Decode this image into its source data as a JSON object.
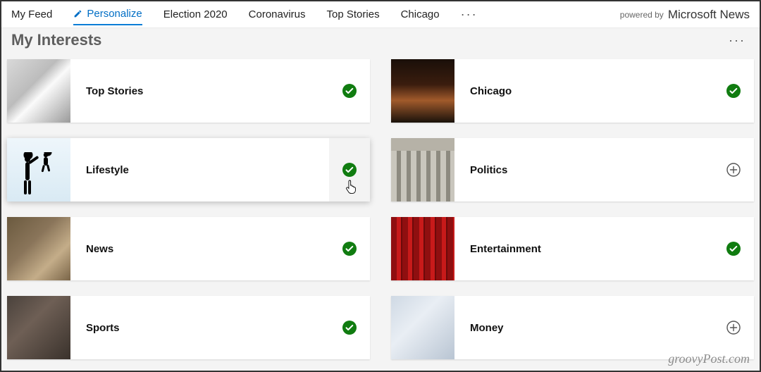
{
  "nav": {
    "tabs": [
      {
        "label": "My Feed",
        "key": "my-feed"
      },
      {
        "label": "Personalize",
        "key": "personalize",
        "active": true,
        "icon": "pencil"
      },
      {
        "label": "Election 2020",
        "key": "election-2020"
      },
      {
        "label": "Coronavirus",
        "key": "coronavirus"
      },
      {
        "label": "Top Stories",
        "key": "top-stories"
      },
      {
        "label": "Chicago",
        "key": "chicago"
      }
    ],
    "more": "···",
    "powered_by_prefix": "powered by",
    "brand": "Microsoft News"
  },
  "heading": {
    "title": "My Interests",
    "more": "···"
  },
  "interests": [
    {
      "key": "top-stories",
      "label": "Top Stories",
      "selected": true,
      "thumb": "th-topstories"
    },
    {
      "key": "chicago",
      "label": "Chicago",
      "selected": true,
      "thumb": "th-chicago"
    },
    {
      "key": "lifestyle",
      "label": "Lifestyle",
      "selected": true,
      "thumb": "th-lifestyle",
      "hover": true
    },
    {
      "key": "politics",
      "label": "Politics",
      "selected": false,
      "thumb": "th-politics"
    },
    {
      "key": "news",
      "label": "News",
      "selected": true,
      "thumb": "th-news"
    },
    {
      "key": "entertainment",
      "label": "Entertainment",
      "selected": true,
      "thumb": "th-entertainment"
    },
    {
      "key": "sports",
      "label": "Sports",
      "selected": true,
      "thumb": "th-sports"
    },
    {
      "key": "money",
      "label": "Money",
      "selected": false,
      "thumb": "th-money"
    }
  ],
  "colors": {
    "accent": "#0b7dd6",
    "check_fill": "#107c10"
  },
  "watermark": "groovyPost.com"
}
